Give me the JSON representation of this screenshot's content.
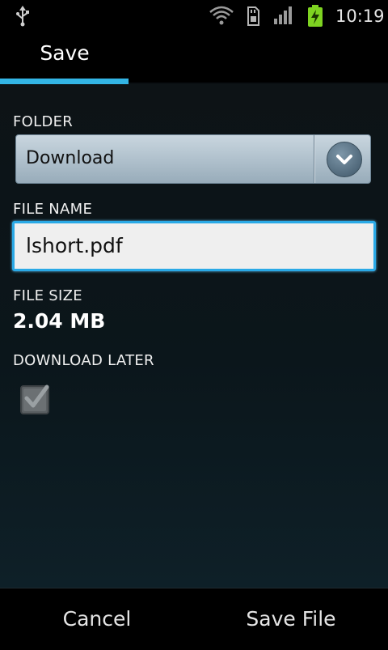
{
  "status_bar": {
    "time": "10:19",
    "icons": [
      "usb-icon",
      "wifi-icon",
      "sd-card-icon",
      "signal-icon",
      "battery-charging-icon"
    ],
    "battery_color": "#7ed321"
  },
  "tab": {
    "label": "Save",
    "indicator_color": "#33b5e5"
  },
  "form": {
    "folder_label": "FOLDER",
    "folder_value": "Download",
    "file_name_label": "FILE NAME",
    "file_name_value": "lshort.pdf",
    "file_size_label": "FILE SIZE",
    "file_size_value": "2.04 MB",
    "download_later_label": "DOWNLOAD LATER",
    "download_later_checked": true
  },
  "actions": {
    "cancel_label": "Cancel",
    "save_label": "Save File"
  }
}
